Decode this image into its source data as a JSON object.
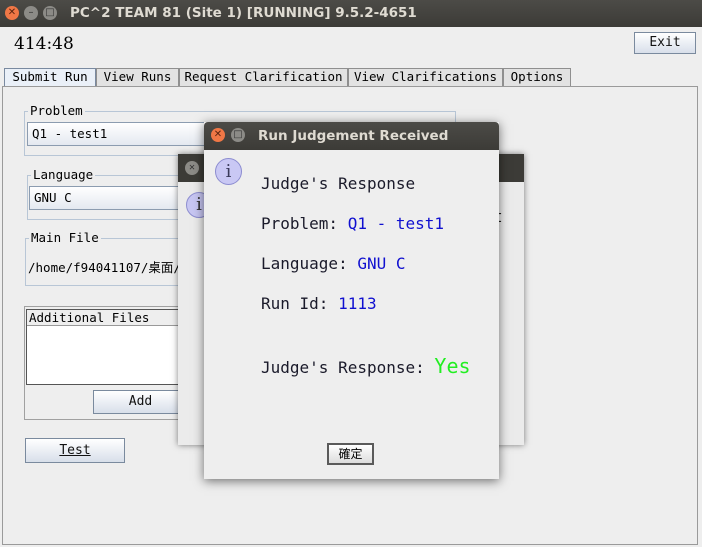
{
  "window": {
    "title": "PC^2 TEAM 81 (Site 1) [RUNNING] 9.5.2-4651",
    "clock": "414:48",
    "exit_label": "Exit"
  },
  "tabs": [
    {
      "label": "Submit Run",
      "selected": true
    },
    {
      "label": "View Runs"
    },
    {
      "label": "Request Clarification"
    },
    {
      "label": "View Clarifications"
    },
    {
      "label": "Options"
    }
  ],
  "submit": {
    "problem_legend": "Problem",
    "problem_value": "Q1 - test1",
    "language_legend": "Language",
    "language_value": "GNU C",
    "mainfile_legend": "Main File",
    "mainfile_value": "/home/f94041107/桌面/G",
    "additional_files_header": "Additional Files",
    "add_label": "Add",
    "test_label": "Test"
  },
  "back_dialog": {
    "partial_text": "t"
  },
  "dialog": {
    "title": "Run Judgement Received",
    "heading": "Judge's Response",
    "problem_label": "Problem:",
    "problem_value": "Q1 - test1",
    "language_label": "Language:",
    "language_value": "GNU C",
    "runid_label": "Run Id:",
    "runid_value": "1113",
    "response_label": "Judge's Response:",
    "response_value": "Yes",
    "ok_label": "確定"
  },
  "colors": {
    "value_blue": "#1010d0",
    "verdict_green": "#22ee22",
    "titlebar": "#3c3b37"
  }
}
